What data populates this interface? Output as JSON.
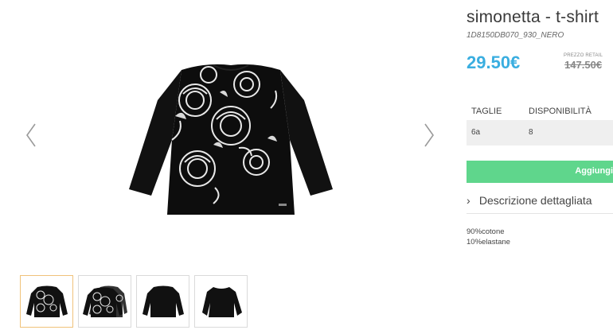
{
  "gallery": {
    "prev_icon": "chevron-left-icon",
    "next_icon": "chevron-right-icon",
    "thumbnails": [
      {
        "name": "thumbnail-1",
        "printed": true,
        "active": true
      },
      {
        "name": "thumbnail-2",
        "printed": true,
        "active": false
      },
      {
        "name": "thumbnail-3",
        "printed": false,
        "active": false
      },
      {
        "name": "thumbnail-4",
        "printed": false,
        "active": false
      }
    ]
  },
  "product": {
    "title": "simonetta - t-shirt",
    "code": "1D8150DB070_930_NERO",
    "price": "29.50€",
    "retail_label": "PREZZO RETAIL",
    "retail_price": "147.50€"
  },
  "sizes": {
    "headers": [
      "TAGLIE",
      "DISPONIBILITÀ"
    ],
    "rows": [
      [
        "6a",
        "8"
      ]
    ]
  },
  "cart": {
    "add_label": "Aggiungi"
  },
  "description": {
    "toggle_label": "Descrizione dettagliata",
    "composition": [
      "90%cotone",
      "10%elastane"
    ]
  },
  "colors": {
    "price": "#3aaee0",
    "button": "#5fd68c",
    "active_thumb_border": "#f0c27a"
  }
}
